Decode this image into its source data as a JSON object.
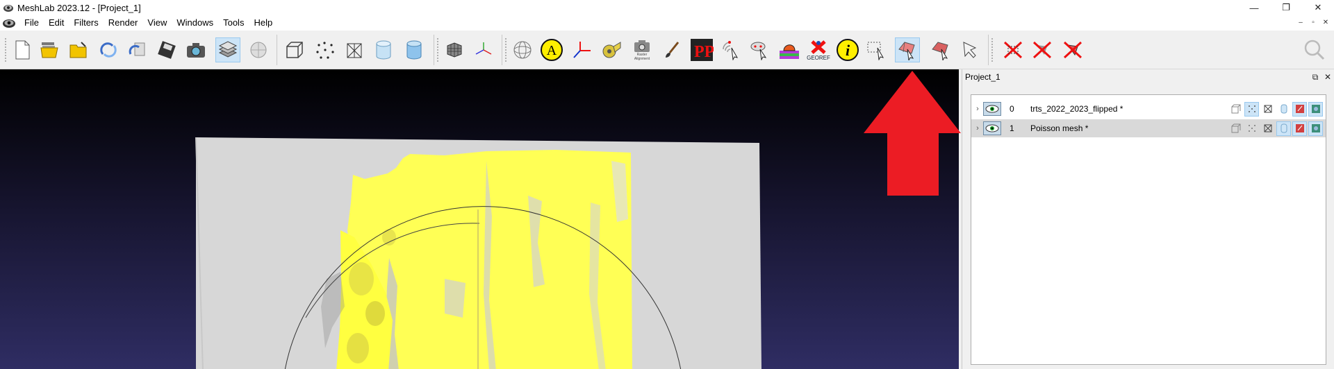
{
  "window": {
    "title": "MeshLab 2023.12 - [Project_1]",
    "controls": {
      "minimize": "—",
      "restore": "❐",
      "close": "✕"
    }
  },
  "menu": {
    "items": [
      {
        "label": "File"
      },
      {
        "label": "Edit"
      },
      {
        "label": "Filters"
      },
      {
        "label": "Render"
      },
      {
        "label": "View"
      },
      {
        "label": "Windows"
      },
      {
        "label": "Tools"
      },
      {
        "label": "Help"
      }
    ],
    "mdi_controls": {
      "minimize": "–",
      "restore": "▫",
      "close": "✕"
    }
  },
  "toolbar": {
    "raster_alignment_caption": "Raster Alignment",
    "georef_caption": "GEOREF",
    "annotation_letter": "A",
    "info_letter": "i",
    "pp_letters": "PP",
    "buttons": [
      "new-project-icon",
      "open-project-icon",
      "import-mesh-icon",
      "reload-icon",
      "reload-all-icon",
      "export-mesh-icon",
      "snapshot-icon",
      "layer-dialog-icon",
      "raster-icon",
      "bbox-icon",
      "points-icon",
      "wireframe-icon",
      "flat-icon",
      "smooth-icon",
      "grid-icon",
      "axis-icon",
      "trackball-icon",
      "annotation-icon",
      "measure-axes-icon",
      "tape-measure-icon",
      "raster-alignment-icon",
      "paint-brush-icon",
      "point-picker-icon",
      "pick-points-icon",
      "align-tool-icon",
      "texture-icon",
      "georef-icon",
      "info-icon",
      "select-vertices-icon",
      "select-faces-icon",
      "select-connected-icon",
      "select-pointer-icon",
      "delete-vertices-icon",
      "delete-faces-icon",
      "delete-faces-vertices-icon",
      "search-icon"
    ]
  },
  "panel": {
    "title": "Project_1",
    "float_label": "⧉",
    "close_label": "✕",
    "layers": [
      {
        "id": "0",
        "name": "trts_2022_2023_flipped *",
        "selected": false
      },
      {
        "id": "1",
        "name": "Poisson mesh *",
        "selected": true
      }
    ]
  },
  "colors": {
    "mesh_yellow": "#ffff55",
    "mesh_grey": "#d7d7d7",
    "annotation_red": "#ec1c24",
    "viewport_top": "#000000",
    "viewport_bottom": "#2f2d63"
  }
}
